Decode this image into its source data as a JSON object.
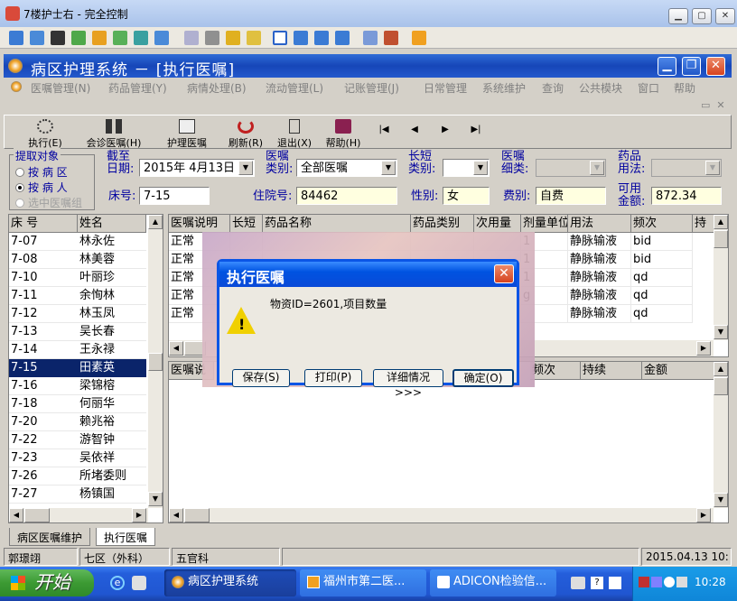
{
  "outer_window": {
    "title": "7楼护士右 - 完全控制"
  },
  "app": {
    "title": "病区护理系统 － [执行医嘱]",
    "menu": [
      "医嘱管理(N)",
      "药品管理(Y)",
      "病情处理(B)",
      "流动管理(L)",
      "记账管理(J)",
      "日常管理",
      "系统维护",
      "查询",
      "公共模块",
      "窗口",
      "帮助"
    ],
    "toolbar": [
      {
        "label": "执行(E)",
        "icon": "execute-icon"
      },
      {
        "label": "会诊医嘱(H)",
        "icon": "binoculars-icon"
      },
      {
        "label": "护理医嘱",
        "icon": "nursing-order-icon"
      },
      {
        "label": "刷新(R)",
        "icon": "refresh-icon"
      },
      {
        "label": "退出(X)",
        "icon": "exit-icon"
      },
      {
        "label": "帮助(H)",
        "icon": "help-book-icon"
      }
    ],
    "nav_arrows": [
      "|◀",
      "◀",
      "▶",
      "▶|"
    ]
  },
  "filter": {
    "group_title": "提取对象",
    "options": [
      {
        "label": "按 病 区",
        "selected": false,
        "enabled": true
      },
      {
        "label": "按 病 人",
        "selected": true,
        "enabled": true
      },
      {
        "label": "选中医嘱组",
        "selected": false,
        "enabled": false
      }
    ],
    "cutoff_label": "截至\n日期:",
    "cutoff_date": "2015年 4月13日",
    "order_type_label": "医嘱\n类别:",
    "order_type_value": "全部医嘱",
    "duration_label": "长短\n类别:",
    "duration_value": "",
    "detail_label": "医嘱\n细类:",
    "detail_value": "",
    "drug_usage_label": "药品\n用法:",
    "drug_usage_value": "",
    "bed_label": "床号:",
    "bed_value": "7-15",
    "admission_label": "住院号:",
    "admission_value": "84462",
    "gender_label": "性别:",
    "gender_value": "女",
    "fee_label": "费别:",
    "fee_value": "自费",
    "available_label": "可用\n金额:",
    "available_value": "872.34"
  },
  "patients": {
    "headers": [
      "床 号",
      "姓名"
    ],
    "rows": [
      [
        "7-07",
        "林永佐"
      ],
      [
        "7-08",
        "林美蓉"
      ],
      [
        "7-10",
        "叶丽珍"
      ],
      [
        "7-11",
        "余恂林"
      ],
      [
        "7-12",
        "林玉凤"
      ],
      [
        "7-13",
        "吴长春"
      ],
      [
        "7-14",
        "王永禄"
      ],
      [
        "7-15",
        "田素英"
      ],
      [
        "7-16",
        "梁锦榕"
      ],
      [
        "7-18",
        "何丽华"
      ],
      [
        "7-20",
        "赖兆裕"
      ],
      [
        "7-22",
        "游智钟"
      ],
      [
        "7-23",
        "吴依祥"
      ],
      [
        "7-26",
        "所堵委则"
      ],
      [
        "7-27",
        "杨镇国"
      ]
    ],
    "selected_index": 7
  },
  "orders": {
    "headers": [
      "医嘱说明",
      "长短",
      "药品名称",
      "药品类别",
      "次用量",
      "剂量单位",
      "用法",
      "频次",
      "持"
    ],
    "rows": [
      [
        "正常",
        "",
        "",
        "",
        "",
        "1",
        "静脉输液",
        "bid"
      ],
      [
        "正常",
        "",
        "",
        "",
        "",
        "1",
        "静脉输液",
        "bid"
      ],
      [
        "正常",
        "",
        "",
        "",
        "",
        "1",
        "静脉输液",
        "qd"
      ],
      [
        "正常",
        "",
        "",
        "",
        "",
        "g",
        "静脉输液",
        "qd"
      ],
      [
        "正常",
        "",
        "",
        "",
        "",
        "",
        "静脉输液",
        "qd"
      ]
    ]
  },
  "details": {
    "headers": [
      "医嘱说",
      "频次",
      "持续",
      "金额"
    ]
  },
  "tabs": [
    "病区医嘱维护",
    "执行医嘱"
  ],
  "dialog": {
    "title": "执行医嘱",
    "message": "物资ID=2601,项目数量",
    "buttons": [
      "保存(S)",
      "打印(P)",
      "详细情况>>>",
      "确定(O)"
    ]
  },
  "status": [
    "郭璟翊",
    "七区（外科）",
    "五官科",
    "",
    "2015.04.13 10:"
  ],
  "taskbar": {
    "start": "开始",
    "tasks": [
      "病区护理系统",
      "福州市第二医...",
      "ADICON检验信..."
    ],
    "time": "10:28"
  },
  "colors": {
    "title_blue": "#1646b8",
    "selection": "#0a246a",
    "taskbar": "#245edb",
    "start_green": "#3c9a33"
  }
}
